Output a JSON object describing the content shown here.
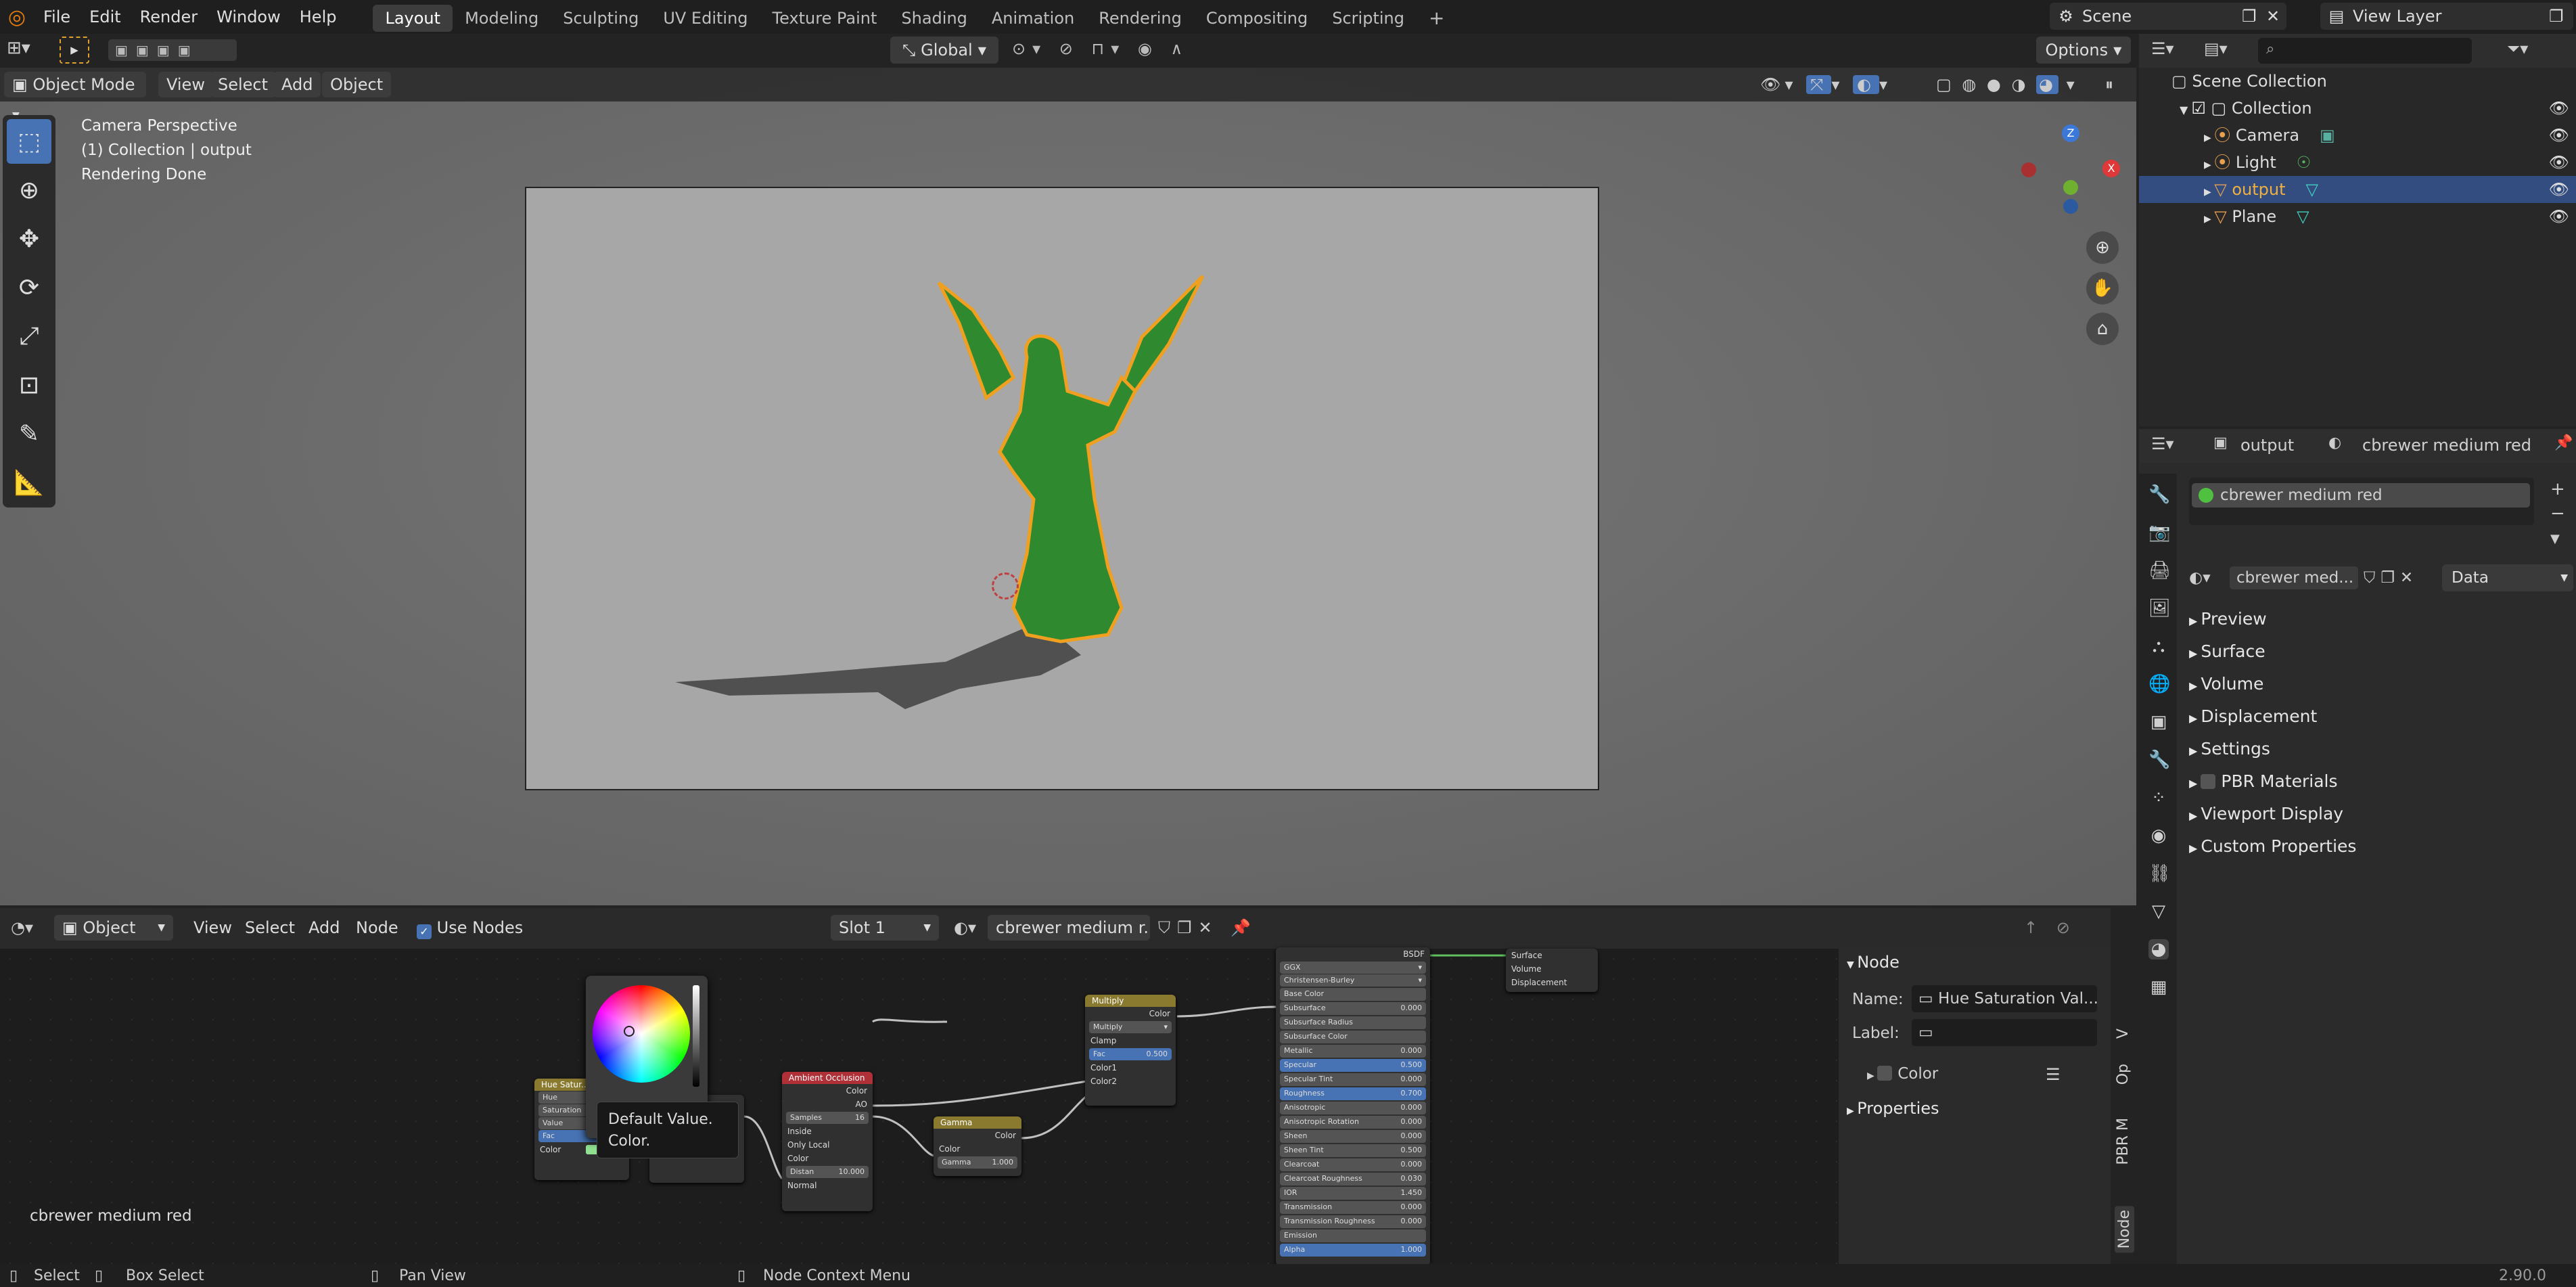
{
  "app": {
    "version": "2.90.0"
  },
  "menus": [
    "File",
    "Edit",
    "Render",
    "Window",
    "Help"
  ],
  "workspaces": [
    "Layout",
    "Modeling",
    "Sculpting",
    "UV Editing",
    "Texture Paint",
    "Shading",
    "Animation",
    "Rendering",
    "Compositing",
    "Scripting"
  ],
  "active_workspace": "Layout",
  "scene": {
    "name": "Scene",
    "view_layer": "View Layer"
  },
  "toolheader": {
    "orientation": "Global",
    "options": "Options"
  },
  "viewport_header": {
    "mode": "Object Mode",
    "view": "View",
    "select": "Select",
    "add": "Add",
    "object": "Object"
  },
  "viewport_overlay": {
    "line1": "Camera Perspective",
    "line2": "(1) Collection | output",
    "line3": "Rendering Done"
  },
  "gizmo": {
    "z": "Z",
    "x": "X"
  },
  "outliner": {
    "search_placeholder": "",
    "root": "Scene Collection",
    "collection": "Collection",
    "items": [
      {
        "name": "Camera",
        "selected": false
      },
      {
        "name": "Light",
        "selected": false
      },
      {
        "name": "output",
        "selected": true
      },
      {
        "name": "Plane",
        "selected": false
      }
    ]
  },
  "properties": {
    "object": "output",
    "material": "cbrewer medium red",
    "slot_item": "cbrewer medium red",
    "material_field": "cbrewer med...",
    "data_dropdown": "Data",
    "panels": [
      "Preview",
      "Surface",
      "Volume",
      "Displacement",
      "Settings",
      "PBR Materials",
      "Viewport Display",
      "Custom Properties"
    ]
  },
  "node_header": {
    "type": "Object",
    "view": "View",
    "select": "Select",
    "add": "Add",
    "node": "Node",
    "use_nodes": "Use Nodes",
    "slot": "Slot 1",
    "material": "cbrewer medium r..."
  },
  "node_editor": {
    "material_label": "cbrewer medium red",
    "tooltip_line1": "Default Value.",
    "tooltip_line2": "Color.",
    "hue_node": {
      "title": "Hue Satur...",
      "rows": [
        "Hue",
        "Saturation",
        "Value",
        "Fac",
        "Color"
      ]
    },
    "ao_node": {
      "title": "Ambient Occlusion",
      "outputs": [
        "Color",
        "AO"
      ],
      "samples": "Samples",
      "samples_val": "16",
      "inside": "Inside",
      "only_local": "Only Local",
      "inputs": [
        "Color"
      ],
      "distance": "Distan",
      "distance_val": "10.000",
      "normal": "Normal"
    },
    "gamma_node": {
      "title": "Gamma",
      "out": "Color",
      "in": "Color",
      "gamma": "Gamma",
      "gamma_val": "1.000"
    },
    "multiply_node": {
      "title": "Multiply",
      "out": "Color",
      "blend": "Multiply",
      "clamp": "Clamp",
      "fac": "Fac",
      "fac_val": "0.500",
      "c1": "Color1",
      "c2": "Color2"
    },
    "bsdf_node": {
      "title": "BSDF",
      "distribution": "GGX",
      "subsurface_method": "Christensen-Burley",
      "rows": [
        {
          "label": "Base Color",
          "val": ""
        },
        {
          "label": "Subsurface",
          "val": "0.000"
        },
        {
          "label": "Subsurface Radius",
          "val": ""
        },
        {
          "label": "Subsurface Color",
          "val": ""
        },
        {
          "label": "Metallic",
          "val": "0.000"
        },
        {
          "label": "Specular",
          "val": "0.500"
        },
        {
          "label": "Specular Tint",
          "val": "0.000"
        },
        {
          "label": "Roughness",
          "val": "0.700"
        },
        {
          "label": "Anisotropic",
          "val": "0.000"
        },
        {
          "label": "Anisotropic Rotation",
          "val": "0.000"
        },
        {
          "label": "Sheen",
          "val": "0.000"
        },
        {
          "label": "Sheen Tint",
          "val": "0.500"
        },
        {
          "label": "Clearcoat",
          "val": "0.000"
        },
        {
          "label": "Clearcoat Roughness",
          "val": "0.030"
        },
        {
          "label": "IOR",
          "val": "1.450"
        },
        {
          "label": "Transmission",
          "val": "0.000"
        },
        {
          "label": "Transmission Roughness",
          "val": "0.000"
        },
        {
          "label": "Emission",
          "val": ""
        },
        {
          "label": "Alpha",
          "val": "1.000"
        }
      ]
    },
    "output_node": {
      "rows": [
        "Surface",
        "Volume",
        "Displacement"
      ]
    }
  },
  "node_sidebar": {
    "section": "Node",
    "name_label": "Name:",
    "name_value": "Hue Saturation Val...",
    "label_label": "Label:",
    "label_value": "",
    "color": "Color",
    "properties": "Properties",
    "tabs": [
      "Node",
      "PBR M",
      "Op",
      "V"
    ]
  },
  "statusbar": {
    "select": "Select",
    "box_select": "Box Select",
    "pan_view": "Pan View",
    "context": "Node Context Menu",
    "version": "2.90.0"
  },
  "colors": {
    "accent": "#4772b3",
    "selected_row": "#334d80",
    "object_green": "#2f8a2f",
    "outline_orange": "#f0a020"
  }
}
